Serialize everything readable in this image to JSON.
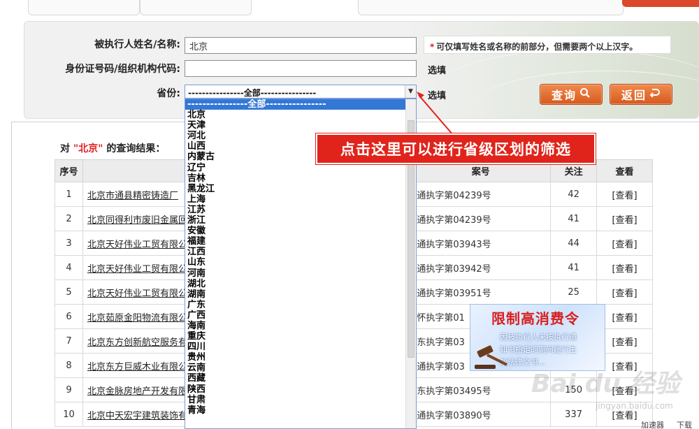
{
  "form": {
    "name_label": "被执行人姓名/名称:",
    "name_value": "北京",
    "id_label": "身份证号码/组织机构代码:",
    "id_value": "",
    "province_label": "省份:",
    "province_value": "----------------全部----------------",
    "hint_star": "*",
    "hint_text": "可仅填写姓名或名称的前部分，但需要两个以上汉字。",
    "optional_1": "选填",
    "optional_2": "选填",
    "search_button": "查询",
    "back_button": "返回"
  },
  "results": {
    "title_prefix": "对 ",
    "title_keyword": "\"北京\"",
    "title_suffix": " 的查询结果：",
    "headers": [
      "序号",
      "被执行人",
      "案号",
      "关注",
      "查看"
    ],
    "rows": [
      {
        "no": "1",
        "name": "北京市通县精密铸造厂",
        "case": "通执字第04239号",
        "follow": "42",
        "view": "[查看]"
      },
      {
        "no": "2",
        "name": "北京同得利市废旧金属回",
        "case": "通执字第04239号",
        "follow": "41",
        "view": "[查看]"
      },
      {
        "no": "3",
        "name": "北京天好伟业工贸有限公",
        "case": "通执字第03943号",
        "follow": "44",
        "view": "[查看]"
      },
      {
        "no": "4",
        "name": "北京天好伟业工贸有限公",
        "case": "通执字第03942号",
        "follow": "41",
        "view": "[查看]"
      },
      {
        "no": "5",
        "name": "北京天好伟业工贸有限公",
        "case": "通执字第03951号",
        "follow": "25",
        "view": "[查看]"
      },
      {
        "no": "6",
        "name": "北京茹原金阳物流有限公",
        "case": "怀执字第01",
        "follow": "",
        "view": "[查看]"
      },
      {
        "no": "7",
        "name": "北京东方创新航空服务有",
        "case": "东执字第03",
        "follow": "",
        "view": "[查看]"
      },
      {
        "no": "8",
        "name": "北京东方巨威木业有限公",
        "case": "通执字第03",
        "follow": "",
        "view": "[查看]"
      },
      {
        "no": "9",
        "name": "北京金脉房地产开发有限",
        "case": "东执字第03495号",
        "follow": "150",
        "view": "[查看]"
      },
      {
        "no": "10",
        "name": "北京中天宏宇建筑装饰有",
        "case": "通执字第03890号",
        "follow": "337",
        "view": "[查看]"
      }
    ]
  },
  "dropdown": {
    "options": [
      "----------------全部----------------",
      "北京",
      "天津",
      "河北",
      "山西",
      "内蒙古",
      "辽宁",
      "吉林",
      "黑龙江",
      "上海",
      "江苏",
      "浙江",
      "安徽",
      "福建",
      "江西",
      "山东",
      "河南",
      "湖北",
      "湖南",
      "广东",
      "广西",
      "海南",
      "重庆",
      "四川",
      "贵州",
      "云南",
      "西藏",
      "陕西",
      "甘肃",
      "青海"
    ],
    "selected_index": 0
  },
  "annotation": {
    "text": "点击这里可以进行省级区划的筛选"
  },
  "banner": {
    "title": "限制高消费令",
    "line1": "因被执行人未按执行通",
    "line2": "知书指定的期间履行生",
    "line3": "效法律文书..."
  },
  "watermark": {
    "text": "Bai du 经验",
    "sub": "jingyan.baidu.com"
  },
  "statusbar": {
    "item1": "加速器",
    "item2": "下载"
  },
  "colors": {
    "accent_orange": "#d65a1e",
    "annotation_red": "#e0241b",
    "dropdown_highlight": "#3478d6"
  }
}
